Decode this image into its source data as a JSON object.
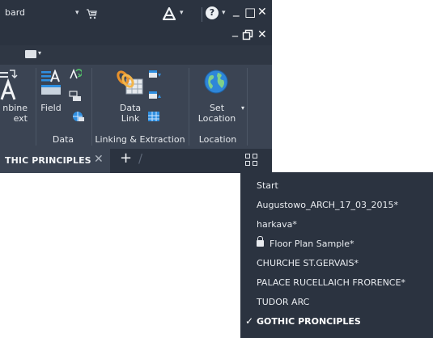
{
  "title_bar": {
    "title_fragment": "bard",
    "help_label": "?",
    "minimize": "_",
    "maximize": "□",
    "close": "✕",
    "doc_minimize": "_",
    "doc_restore": "🗗",
    "doc_close": "✕"
  },
  "ribbon": {
    "combine_label_1": "nbine",
    "combine_label_2": "ext",
    "field_label": "Field",
    "data_panel_title": "Data",
    "data_link_label_1": "Data",
    "data_link_label_2": "Link",
    "linking_panel_title": "Linking & Extraction",
    "set_location_label_1": "Set",
    "set_location_label_2": "Location",
    "location_panel_title": "Location"
  },
  "tabs": {
    "active_label": "THIC PRINCIPLES",
    "close": "✕",
    "add": "+"
  },
  "menu": {
    "items": [
      {
        "label": "Start"
      },
      {
        "label": "Augustowo_ARCH_17_03_2015*"
      },
      {
        "label": "harkava*"
      },
      {
        "label": "Floor Plan Sample*",
        "locked": true
      },
      {
        "label": "CHURCHE ST.GERVAIS*"
      },
      {
        "label": "PALACE RUCELLAICH FRORENCE*"
      },
      {
        "label": "TUDOR ARC"
      },
      {
        "label": "GOTHIC PRONCIPLES",
        "current": true
      }
    ],
    "check_mark": "✓"
  },
  "colors": {
    "ribbon_bg": "#3b4453",
    "titlebar_bg": "#2b3340",
    "menu_bg": "#2b3340",
    "accent_blue": "#2f8fe0"
  }
}
